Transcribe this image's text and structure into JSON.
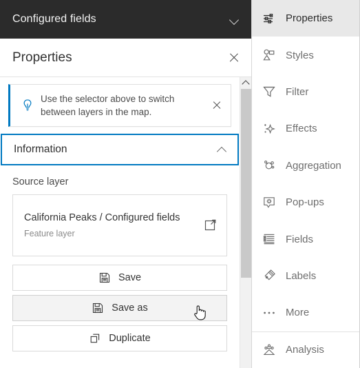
{
  "left_panel": {
    "layer_selector": {
      "title": "Configured fields",
      "chevron": "chevron-down-icon"
    },
    "properties_header": {
      "title": "Properties",
      "close": "close-icon"
    },
    "tip": {
      "icon": "lightbulb-icon",
      "text": "Use the selector above to switch between layers in the map.",
      "close": "close-icon"
    },
    "accordion": {
      "label": "Information",
      "chevron": "chevron-up-icon",
      "expanded": true,
      "focus_color": "#0079c1"
    },
    "source_layer": {
      "section_label": "Source layer",
      "title": "California Peaks / Configured fields",
      "subtitle": "Feature layer",
      "link_icon": "external-link-icon"
    },
    "actions": [
      {
        "label": "Save",
        "icon": "save-icon",
        "hovered": false
      },
      {
        "label": "Save as",
        "icon": "save-as-icon",
        "hovered": true
      },
      {
        "label": "Duplicate",
        "icon": "duplicate-icon",
        "hovered": false
      }
    ],
    "scrollbar": {
      "up_arrow": "scroll-up-arrow-icon",
      "thumb": "scroll-thumb"
    }
  },
  "sidebar": {
    "items": [
      {
        "label": "Properties",
        "icon": "sliders-icon",
        "active": true,
        "divided": false
      },
      {
        "label": "Styles",
        "icon": "styles-icon",
        "active": false,
        "divided": false
      },
      {
        "label": "Filter",
        "icon": "funnel-icon",
        "active": false,
        "divided": false
      },
      {
        "label": "Effects",
        "icon": "sparkle-icon",
        "active": false,
        "divided": false
      },
      {
        "label": "Aggregation",
        "icon": "aggregation-icon",
        "active": false,
        "divided": false
      },
      {
        "label": "Pop-ups",
        "icon": "popup-gear-icon",
        "active": false,
        "divided": false
      },
      {
        "label": "Fields",
        "icon": "fields-list-icon",
        "active": false,
        "divided": false
      },
      {
        "label": "Labels",
        "icon": "label-tag-icon",
        "active": false,
        "divided": false
      },
      {
        "label": "More",
        "icon": "ellipsis-icon",
        "active": false,
        "divided": false
      },
      {
        "label": "Analysis",
        "icon": "analysis-icon",
        "active": false,
        "divided": true
      }
    ]
  },
  "cursor": {
    "type": "pointing-hand-cursor"
  },
  "colors": {
    "header_bg": "#2b2b2b",
    "accent": "#0079c1",
    "active_item_bg": "#e8e8e8",
    "text_primary": "#323232",
    "text_muted": "#6e6e6e"
  }
}
